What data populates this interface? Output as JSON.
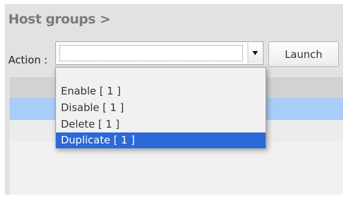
{
  "header": {
    "title": "Host groups >"
  },
  "action_bar": {
    "label": "Action :",
    "select_value": "",
    "launch_label": "Launch"
  },
  "dropdown": {
    "options": [
      {
        "label": "Enable [ 1 ]"
      },
      {
        "label": "Disable [ 1 ]"
      },
      {
        "label": "Delete [ 1 ]"
      },
      {
        "label": "Duplicate [ 1 ]"
      }
    ],
    "highlighted": "Duplicate [ 1 ]"
  },
  "colors": {
    "highlight": "#2b68d8",
    "selected_row": "#a8cdf8",
    "title": "#7a7a7a"
  },
  "icons": {
    "select_arrow": "chevron-down-icon"
  }
}
